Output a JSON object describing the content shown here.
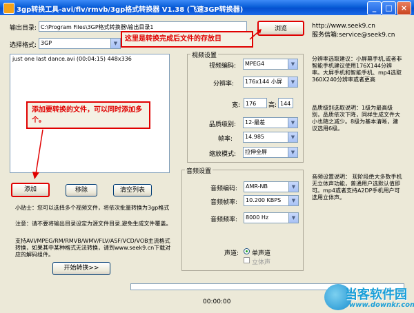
{
  "window": {
    "title": "3gp转换工具-avi/flv/rmvb/3gp格式转换器 V1.38 (飞速3GP转换器)",
    "min_label": "_",
    "max_label": "□",
    "close_label": "×"
  },
  "output": {
    "label": "输出目录:",
    "value": "C:\\Program Files\\3GP格式转换器\\输出目录1",
    "browse_label": "浏览",
    "site": "http://www.seek9.cn",
    "service": "服务信箱:service@seek9.cn"
  },
  "format": {
    "label": "选择格式:",
    "value": "3GP"
  },
  "files": [
    "just one last dance.avi (00:04:15) 448x336"
  ],
  "annotations": {
    "output_note": "这里是转换完成后文件的存放目",
    "add_note": "添加要转换的文件，可以同时添加多个。"
  },
  "buttons": {
    "add": "添加",
    "remove": "移除",
    "clear": "清空列表",
    "start": "开始转换>>"
  },
  "tips": {
    "tip1": "小贴士：您可以选择多个视频文件，将依次批量转换为3gp格式",
    "tip2": "注意：请不要将输出目录设定为源文件目录,避免生成文件覆盖。",
    "tip3": "支持AVI/MPEG/RM/RMVB/WMV/FLV/ASF/VCD/VOB主流格式转换，如果其中某种格式无法转换，请到www.seek9.cn下载对应的解码组件。"
  },
  "video": {
    "group_label": "视频设置",
    "codec_label": "视频编码:",
    "codec_value": "MPEG4",
    "resolution_label": "分辨率:",
    "resolution_value": "176x144 小屏",
    "width_label": "宽:",
    "width_value": "176",
    "height_label": "高:",
    "height_value": "144",
    "quality_label": "品质级别:",
    "quality_value": "12-最差",
    "fps_label": "帧率:",
    "fps_value": "14.985",
    "scale_label": "缩放模式:",
    "scale_value": "拉伸全屏"
  },
  "audio": {
    "group_label": "音频设置",
    "codec_label": "音频编码:",
    "codec_value": "AMR-NB",
    "bitrate_label": "音频帧率:",
    "bitrate_value": "10.200 KBPS",
    "samplerate_label": "音频频率:",
    "samplerate_value": "8000 Hz",
    "channel_label": "声道:",
    "mono_label": "单声道",
    "stereo_label": "立体声"
  },
  "help": {
    "resolution": "分辨率选取建议：小屏幕手机,或者非智能手机建议使用176X144分辨率。大屏手机和智能手机、mp4选取360X240分辨率或者更高",
    "quality": "品质级别选取说明：1级为最高级别，品质依次下降，同样生成文件大小也随之减少。8级为基本清晰，建议选用6级。",
    "audio": "音频设置说明：   现阶段绝大多数手机无立体声功能，普通用户选默认值即可。mp4或者支持A2DP手机用户可选用立体声。"
  },
  "status": {
    "time": "00:00:00",
    "progress": 0
  },
  "watermark": {
    "brand": "当客软件园",
    "url": "www.downkr.com"
  },
  "colors": {
    "accent": "#e00000",
    "title_bar": "#0a5fd8",
    "watermark": "#1a9fd8"
  }
}
